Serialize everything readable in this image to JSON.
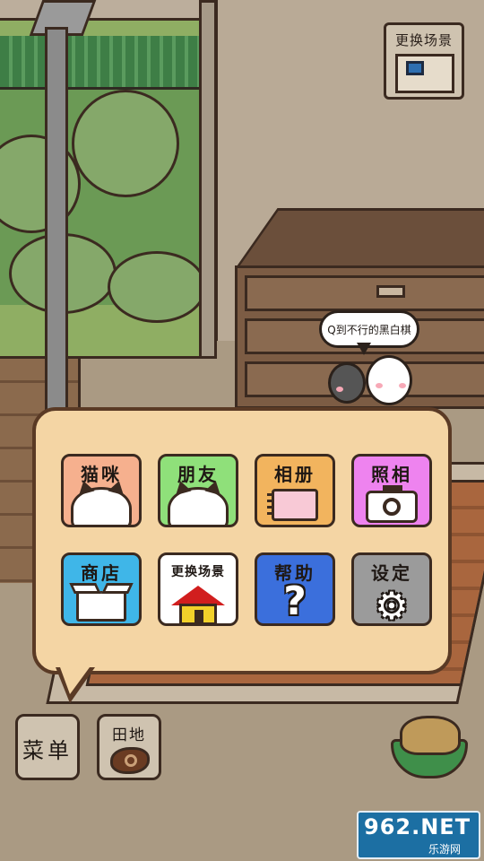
{
  "scene": {
    "change_scene_label": "更换场景",
    "speech_bubble": "Q到不行的黑白棋"
  },
  "menu": {
    "tiles": [
      {
        "label": "猫咪",
        "color": "#f6b08e",
        "icon": "cat-face-icon"
      },
      {
        "label": "朋友",
        "color": "#8fe07a",
        "icon": "dog-face-icon"
      },
      {
        "label": "相册",
        "color": "#f2b45e",
        "icon": "album-icon"
      },
      {
        "label": "照相",
        "color": "#ee83ef",
        "icon": "camera-icon"
      },
      {
        "label": "商店",
        "color": "#3fb6e8",
        "icon": "box-icon"
      },
      {
        "label": "更换场景",
        "color": "#ffffff",
        "icon": "house-icon"
      },
      {
        "label": "帮助",
        "color": "#3b6fdc",
        "icon": "question-icon"
      },
      {
        "label": "设定",
        "color": "#9b9b9b",
        "icon": "gear-icon"
      }
    ]
  },
  "bottom_bar": {
    "menu_label": "菜单",
    "field_label": "田地"
  },
  "watermark": {
    "brand": "962.NET",
    "subtitle": "乐游网"
  }
}
